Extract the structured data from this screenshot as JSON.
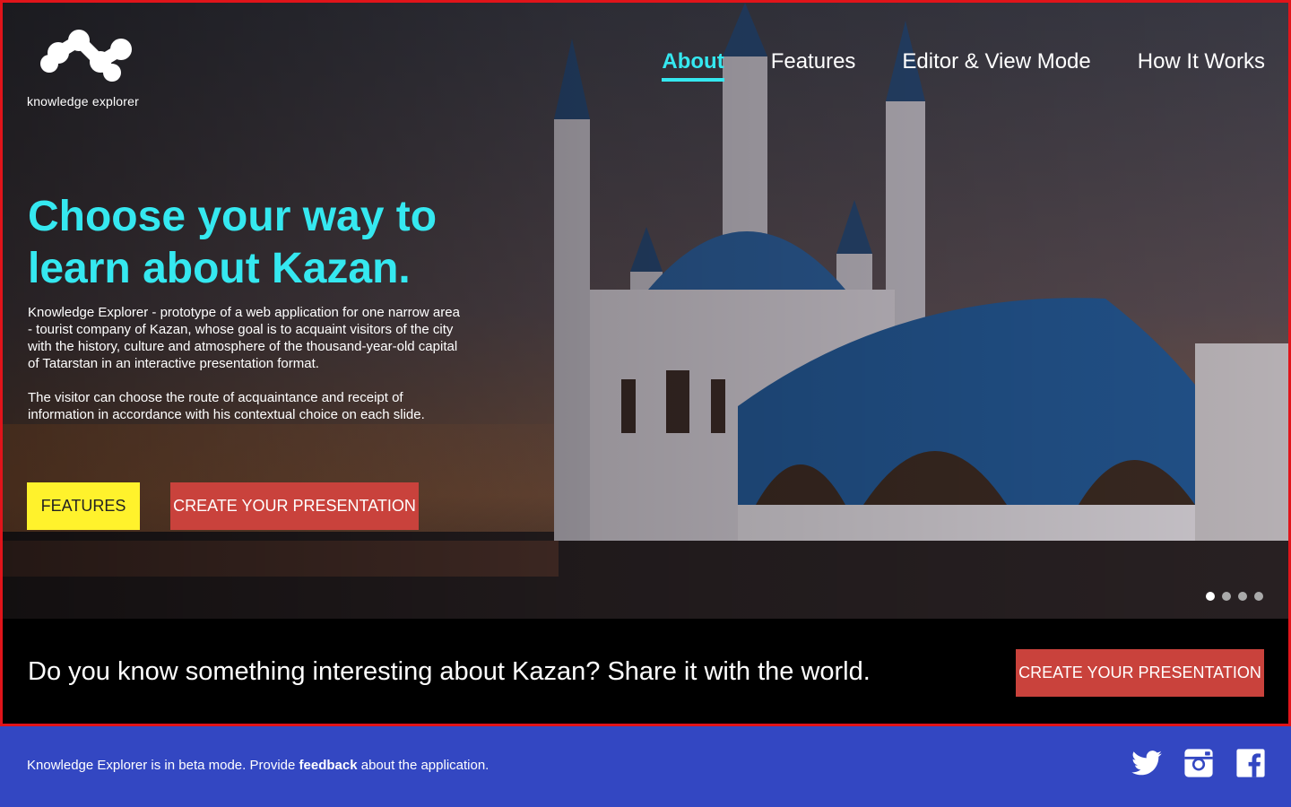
{
  "brand": {
    "name": "knowledge explorer"
  },
  "nav": {
    "items": [
      {
        "label": "About",
        "active": true
      },
      {
        "label": "Features",
        "active": false
      },
      {
        "label": "Editor & View Mode",
        "active": false
      },
      {
        "label": "How It Works",
        "active": false
      }
    ]
  },
  "hero": {
    "headline": "Choose your way to learn about Kazan.",
    "paragraphs": [
      "Knowledge Explorer - prototype of a web application for one narrow area - tourist company of Kazan, whose goal is to acquaint visitors of the city with the history, culture and atmosphere of the thousand-year-old capital of Tatarstan in an interactive presentation format.",
      "The visitor can choose the route of acquaintance and receipt of information in accordance with his contextual choice on each slide."
    ],
    "features_button": "FEATURES",
    "create_button": "CREATE YOUR PRESENTATION",
    "slider": {
      "count": 4,
      "active_index": 0
    }
  },
  "band": {
    "text": "Do you know something interesting about Kazan? Share it with the world.",
    "create_button": "CREATE YOUR PRESENTATION"
  },
  "footer": {
    "text_before": "Knowledge Explorer is in beta mode. Provide ",
    "link": "feedback",
    "text_after": " about the application.",
    "social": [
      "twitter-icon",
      "instagram-icon",
      "facebook-icon"
    ]
  },
  "colors": {
    "accent": "#35e8f0",
    "features_button": "#fff22c",
    "create_button": "#c9423c",
    "footer": "#3347c2",
    "frame_border": "#e0141a"
  }
}
